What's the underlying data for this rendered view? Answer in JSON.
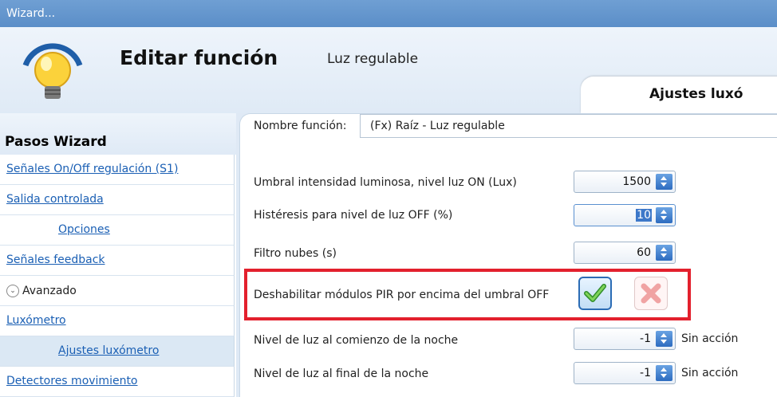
{
  "window": {
    "title": "Wizard..."
  },
  "header": {
    "title": "Editar función",
    "subtitle": "Luz regulable",
    "tab_label": "Ajustes luxó"
  },
  "sidebar": {
    "heading": "Pasos Wizard",
    "items": [
      {
        "label": "Señales On/Off regulación (S1)"
      },
      {
        "label": "Salida controlada"
      },
      {
        "label": "Opciones"
      },
      {
        "label": "Señales feedback"
      },
      {
        "label": "Avanzado"
      },
      {
        "label": "Luxómetro"
      },
      {
        "label": "Ajustes luxómetro"
      },
      {
        "label": "Detectores movimiento"
      }
    ]
  },
  "form": {
    "name_label": "Nombre función:",
    "name_value": "(Fx) Raíz - Luz regulable",
    "fields": [
      {
        "label": "Umbral intensidad luminosa, nivel luz ON (Lux)",
        "value": "1500"
      },
      {
        "label": "Histéresis para nivel de luz OFF (%)",
        "value": "10"
      },
      {
        "label": "Filtro nubes (s)",
        "value": "60"
      },
      {
        "label": "Deshabilitar módulos PIR por encima del umbral OFF"
      },
      {
        "label": "Nivel de luz al comienzo de la noche",
        "value": "-1",
        "suffix": "Sin acción"
      },
      {
        "label": "Nivel de luz al final de la noche",
        "value": "-1",
        "suffix": "Sin acción"
      }
    ]
  },
  "colors": {
    "accent": "#2b6cb5",
    "highlight": "#e3202d",
    "titlebar": "#5b8ec8"
  }
}
